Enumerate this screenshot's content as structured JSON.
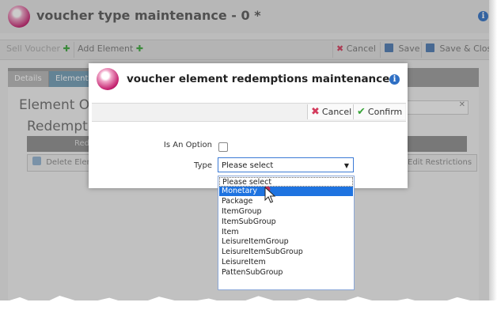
{
  "background_window": {
    "title": "voucher type maintenance - 0 *",
    "toolbar": {
      "sell_voucher": "Sell Voucher",
      "add_element": "Add Element",
      "cancel": "Cancel",
      "save": "Save",
      "save_close": "Save & Close"
    },
    "tabs": [
      {
        "label": "Details"
      },
      {
        "label": "Elements"
      }
    ],
    "heading_element": "Element Or",
    "heading_redemptions": "Redemptio",
    "grid_header": "Red",
    "delete_button": "Delete Eleme",
    "edit_restrictions": "Edit Restrictions",
    "clear_glyph": "✕"
  },
  "modal": {
    "title": "voucher element redemptions maintenance",
    "toolbar": {
      "cancel_label": "Cancel",
      "confirm_label": "Confirm"
    },
    "fields": {
      "is_option_label": "Is An Option",
      "is_option_checked": false,
      "type_label": "Type",
      "type_value": "Please select"
    }
  },
  "dropdown": {
    "options": [
      "Please select",
      "Monetary",
      "Package",
      "ItemGroup",
      "ItemSubGroup",
      "Item",
      "LeisureItemGroup",
      "LeisureItemSubGroup",
      "LeisureItem",
      "PattenSubGroup"
    ],
    "highlighted_index": 1
  },
  "icons": {
    "info": "info-icon",
    "logo": "logo-icon",
    "cursor": "mouse-pointer-icon"
  },
  "colors": {
    "accent_blue": "#1e73e0",
    "cancel_red": "#d33b5c",
    "confirm_green": "#3aa53a"
  }
}
